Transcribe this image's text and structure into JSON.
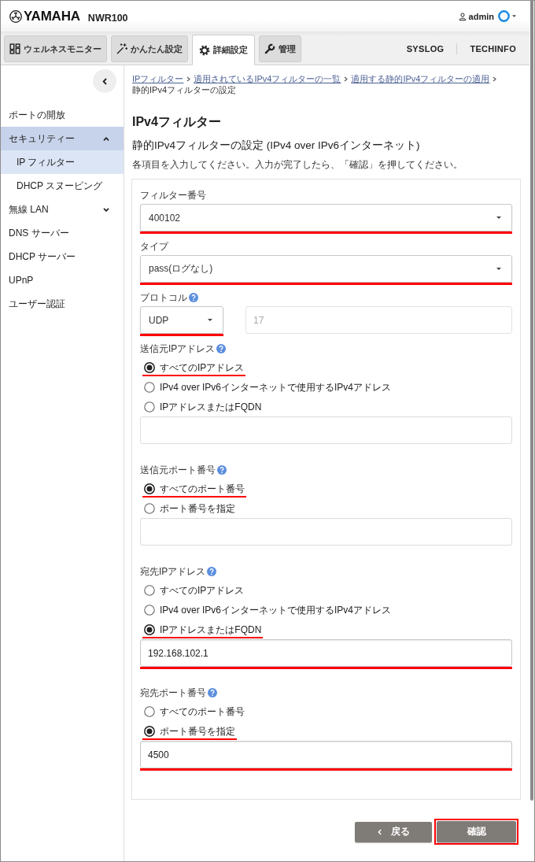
{
  "header": {
    "logo": "YAMAHA",
    "model": "NWR100",
    "user": "admin"
  },
  "tabs": [
    {
      "label": "ウェルネスモニター",
      "selected": false
    },
    {
      "label": "かんたん設定",
      "selected": false
    },
    {
      "label": "詳細設定",
      "selected": true
    },
    {
      "label": "管理",
      "selected": false
    }
  ],
  "header_links": [
    "SYSLOG",
    "TECHINFO"
  ],
  "sidebar": {
    "items": [
      {
        "kind": "page",
        "label": "ポートの開放",
        "selected": false
      },
      {
        "kind": "group",
        "label": "セキュリティー",
        "selected": false,
        "expanded": true,
        "children": [
          {
            "label": "IP フィルター",
            "selected": true
          },
          {
            "label": "DHCP スヌーピング",
            "selected": false
          }
        ]
      },
      {
        "kind": "group",
        "label": "無線 LAN",
        "selected": false,
        "expanded": false
      },
      {
        "kind": "page",
        "label": "DNS サーバー",
        "selected": false
      },
      {
        "kind": "page",
        "label": "DHCP サーバー",
        "selected": false
      },
      {
        "kind": "page",
        "label": "UPnP",
        "selected": false
      },
      {
        "kind": "page",
        "label": "ユーザー認証",
        "selected": false
      }
    ]
  },
  "breadcrumb": [
    {
      "label": "IPフィルター",
      "link": true
    },
    {
      "label": "適用されているIPv4フィルターの一覧",
      "link": true
    },
    {
      "label": "適用する静的IPv4フィルターの適用",
      "link": true
    },
    {
      "label": "静的IPv4フィルターの設定",
      "link": false
    }
  ],
  "page": {
    "title": "IPv4フィルター",
    "subtitle": "静的IPv4フィルターの設定 (IPv4 over IPv6インターネット)",
    "description": "各項目を入力してください。入力が完了したら、「確認」を押してください。"
  },
  "form": {
    "fields": [
      {
        "kind": "select",
        "label": "フィルター番号",
        "help": false,
        "value": "400102",
        "highlighted": true
      },
      {
        "kind": "select",
        "label": "タイプ",
        "help": false,
        "value": "pass(ログなし)",
        "highlighted": true
      },
      {
        "kind": "protocol",
        "label": "プロトコル",
        "help": true,
        "select": {
          "value": "UDP",
          "highlighted": true
        },
        "number": {
          "value": "17",
          "disabled": true
        }
      },
      {
        "kind": "radio",
        "label": "送信元IPアドレス",
        "help": true,
        "options": [
          {
            "label": "すべてのIPアドレス",
            "selected": true,
            "highlighted": true
          },
          {
            "label": "IPv4 over IPv6インターネットで使用するIPv4アドレス",
            "selected": false,
            "highlighted": false
          },
          {
            "label": "IPアドレスまたはFQDN",
            "selected": false,
            "highlighted": false
          }
        ],
        "input": {
          "highlighted": false
        }
      },
      {
        "kind": "radio",
        "label": "送信元ポート番号",
        "help": true,
        "options": [
          {
            "label": "すべてのポート番号",
            "selected": true,
            "highlighted": true
          },
          {
            "label": "ポート番号を指定",
            "selected": false,
            "highlighted": false
          }
        ],
        "input": {
          "highlighted": false
        }
      },
      {
        "kind": "radio",
        "label": "宛先IPアドレス",
        "help": true,
        "options": [
          {
            "label": "すべてのIPアドレス",
            "selected": false,
            "highlighted": false
          },
          {
            "label": "IPv4 over IPv6インターネットで使用するIPv4アドレス",
            "selected": false,
            "highlighted": false
          },
          {
            "label": "IPアドレスまたはFQDN",
            "selected": true,
            "highlighted": true
          }
        ],
        "input": {
          "value": "192.168.102.1",
          "highlighted": true
        }
      },
      {
        "kind": "radio",
        "label": "宛先ポート番号",
        "help": true,
        "options": [
          {
            "label": "すべてのポート番号",
            "selected": false,
            "highlighted": false
          },
          {
            "label": "ポート番号を指定",
            "selected": true,
            "highlighted": true
          }
        ],
        "input": {
          "value": "4500",
          "highlighted": true
        }
      }
    ]
  },
  "buttons": [
    {
      "kind": "back",
      "label": "戻る",
      "highlighted": false
    },
    {
      "kind": "confirm",
      "label": "確認",
      "highlighted": true
    }
  ]
}
